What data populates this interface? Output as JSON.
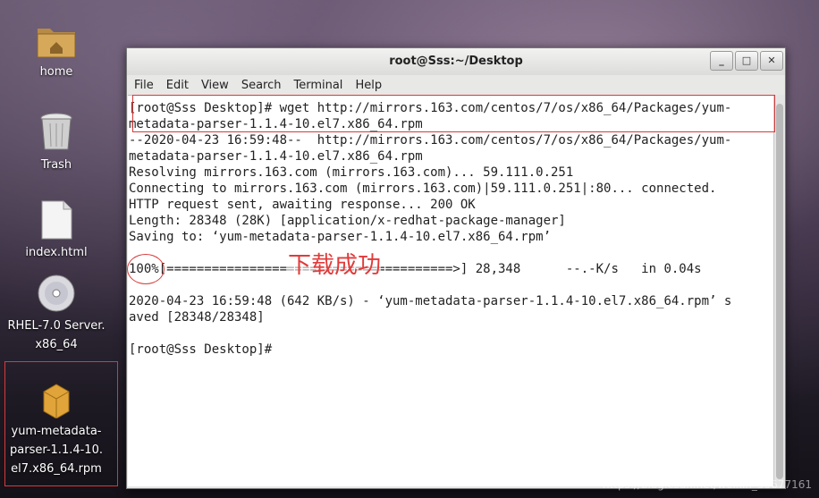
{
  "desktop": {
    "icons": [
      {
        "label1": "home",
        "label2": ""
      },
      {
        "label1": "Trash",
        "label2": ""
      },
      {
        "label1": "index.html",
        "label2": ""
      },
      {
        "label1": "RHEL-7.0 Server.",
        "label2": "x86_64"
      },
      {
        "label1": "yum-metadata-",
        "label2": "parser-1.1.4-10.",
        "label3": "el7.x86_64.rpm"
      }
    ]
  },
  "window": {
    "title": "root@Sss:~/Desktop",
    "buttons": [
      "_",
      "□",
      "✕"
    ],
    "menu": [
      "File",
      "Edit",
      "View",
      "Search",
      "Terminal",
      "Help"
    ]
  },
  "terminal": {
    "lines": [
      "[root@Sss Desktop]# wget http://mirrors.163.com/centos/7/os/x86_64/Packages/yum-",
      "metadata-parser-1.1.4-10.el7.x86_64.rpm",
      "--2020-04-23 16:59:48--  http://mirrors.163.com/centos/7/os/x86_64/Packages/yum-",
      "metadata-parser-1.1.4-10.el7.x86_64.rpm",
      "Resolving mirrors.163.com (mirrors.163.com)... 59.111.0.251",
      "Connecting to mirrors.163.com (mirrors.163.com)|59.111.0.251|:80... connected.",
      "HTTP request sent, awaiting response... 200 OK",
      "Length: 28348 (28K) [application/x-redhat-package-manager]",
      "Saving to: ‘yum-metadata-parser-1.1.4-10.el7.x86_64.rpm’",
      "",
      "100%[======================================>] 28,348      --.-K/s   in 0.04s",
      "",
      "2020-04-23 16:59:48 (642 KB/s) - ‘yum-metadata-parser-1.1.4-10.el7.x86_64.rpm’ s",
      "aved [28348/28348]",
      "",
      "[root@Sss Desktop]#"
    ]
  },
  "annotation": {
    "note": "下载成功"
  },
  "watermark": "https://blog.csdn.net/weixin_50677161"
}
